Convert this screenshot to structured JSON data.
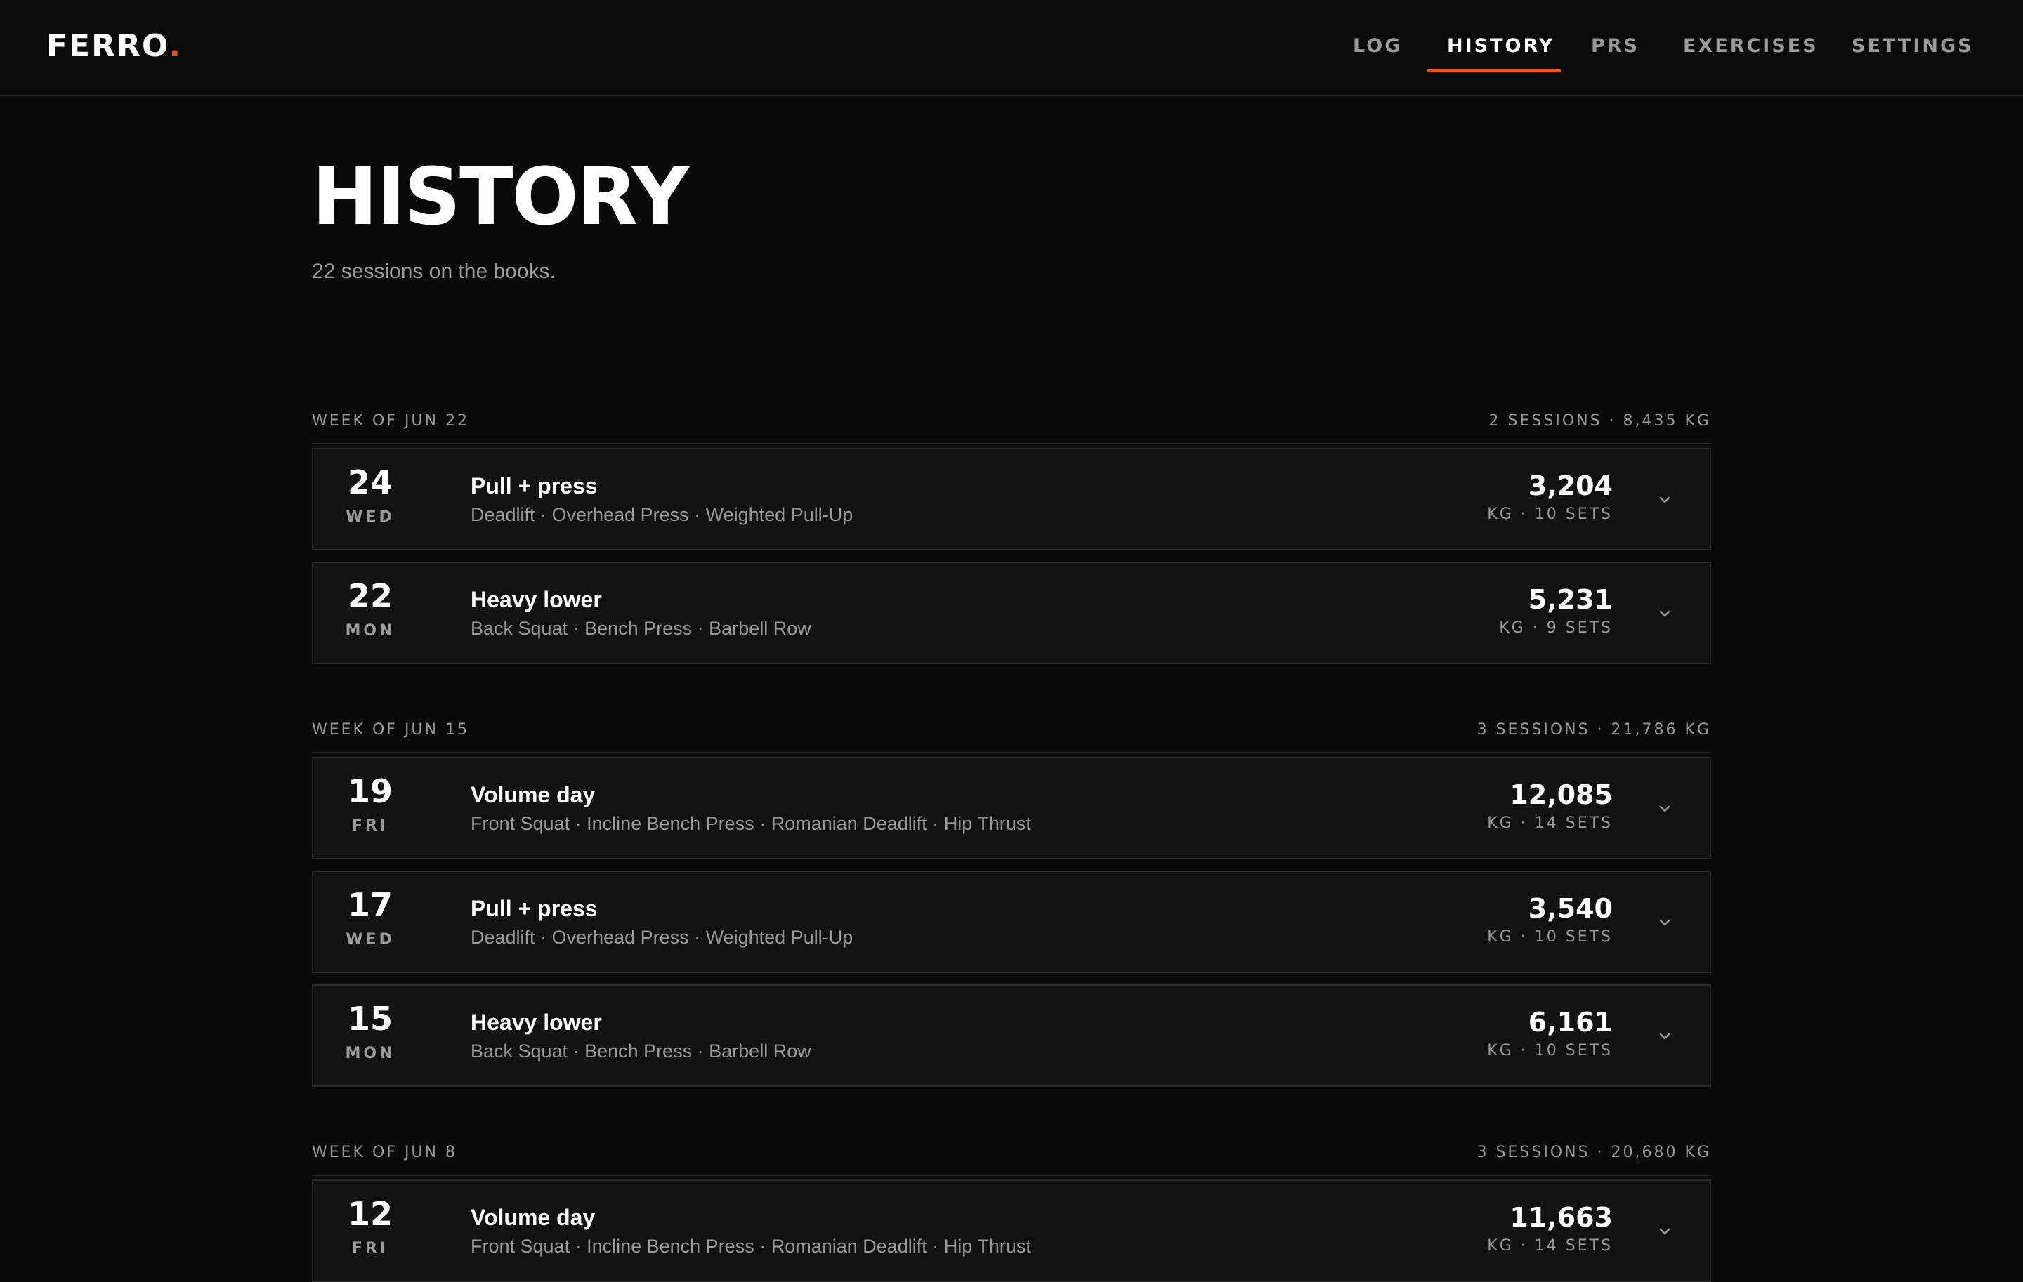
{
  "app": {
    "logo_text": "FERRO",
    "logo_dot": ".",
    "accent_color": "#e8521e"
  },
  "nav": {
    "items": [
      {
        "label": "LOG",
        "active": false
      },
      {
        "label": "HISTORY",
        "active": true
      },
      {
        "label": "PRS",
        "active": false
      },
      {
        "label": "EXERCISES",
        "active": false
      },
      {
        "label": "SETTINGS",
        "active": false
      }
    ]
  },
  "page": {
    "title": "HISTORY",
    "subtitle": "22 sessions on the books."
  },
  "weeks": [
    {
      "label": "WEEK OF JUN 22",
      "summary": "2 SESSIONS · 8,435 KG",
      "sessions": [
        {
          "day_num": "24",
          "day_name": "WED",
          "name": "Pull + press",
          "exercises": "Deadlift · Overhead Press · Weighted Pull-Up",
          "volume": "3,204",
          "meta": "KG · 10 SETS",
          "icon": "chevron-down-icon"
        },
        {
          "day_num": "22",
          "day_name": "MON",
          "name": "Heavy lower",
          "exercises": "Back Squat · Bench Press · Barbell Row",
          "volume": "5,231",
          "meta": "KG · 9 SETS",
          "icon": "chevron-down-icon"
        }
      ]
    },
    {
      "label": "WEEK OF JUN 15",
      "summary": "3 SESSIONS · 21,786 KG",
      "sessions": [
        {
          "day_num": "19",
          "day_name": "FRI",
          "name": "Volume day",
          "exercises": "Front Squat · Incline Bench Press · Romanian Deadlift · Hip Thrust",
          "volume": "12,085",
          "meta": "KG · 14 SETS",
          "icon": "chevron-down-icon"
        },
        {
          "day_num": "17",
          "day_name": "WED",
          "name": "Pull + press",
          "exercises": "Deadlift · Overhead Press · Weighted Pull-Up",
          "volume": "3,540",
          "meta": "KG · 10 SETS",
          "icon": "chevron-down-icon"
        },
        {
          "day_num": "15",
          "day_name": "MON",
          "name": "Heavy lower",
          "exercises": "Back Squat · Bench Press · Barbell Row",
          "volume": "6,161",
          "meta": "KG · 10 SETS",
          "icon": "chevron-down-icon"
        }
      ]
    },
    {
      "label": "WEEK OF JUN 8",
      "summary": "3 SESSIONS · 20,680 KG",
      "sessions": [
        {
          "day_num": "12",
          "day_name": "FRI",
          "name": "Volume day",
          "exercises": "Front Squat · Incline Bench Press · Romanian Deadlift · Hip Thrust",
          "volume": "11,663",
          "meta": "KG · 14 SETS",
          "icon": "chevron-down-icon"
        }
      ]
    }
  ]
}
